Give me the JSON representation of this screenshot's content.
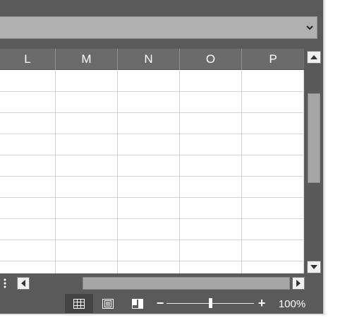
{
  "columns": [
    "L",
    "M",
    "N",
    "O",
    "P"
  ],
  "formula_bar": {
    "value": "",
    "expand_icon": "chevron-down-icon"
  },
  "row_count_visible": 10,
  "status_bar": {
    "views": [
      "normal-view-icon",
      "page-layout-view-icon",
      "page-break-preview-icon"
    ],
    "zoom_minus": "−",
    "zoom_plus": "+",
    "zoom_level": "100%",
    "zoom_fraction": 0.5
  },
  "colors": {
    "chrome": "#5a5a5a",
    "header": "#6b6b6b",
    "gridline": "#d4d4d4",
    "selected_view": "#444444"
  }
}
